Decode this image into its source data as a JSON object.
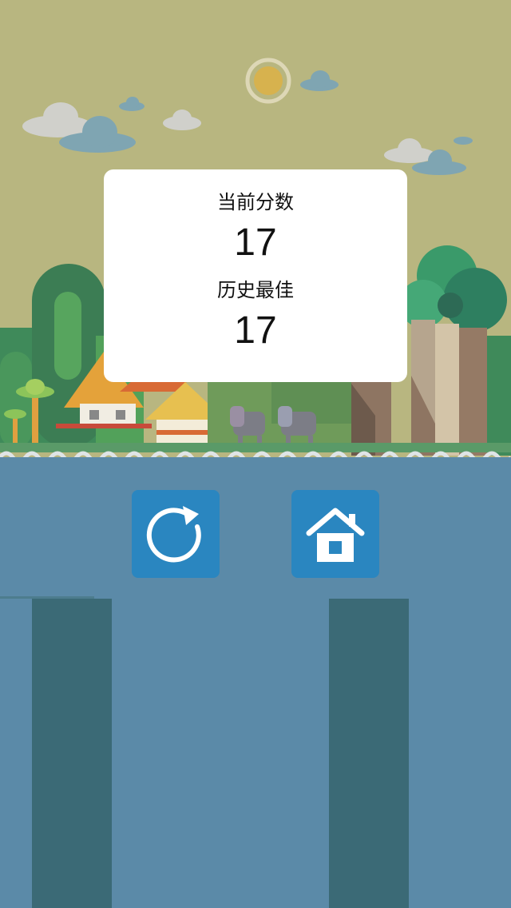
{
  "scene": {
    "colors": {
      "sky": "#b8b680",
      "water": "#5b8aa8",
      "pillar": "#3b6a76",
      "button": "#2a86c0",
      "panel": "#ffffff"
    },
    "background_elements": [
      "sun",
      "clouds",
      "palm-trees",
      "huts",
      "elephants",
      "jungle-trees",
      "wave-shoreline"
    ]
  },
  "score_panel": {
    "current_label": "当前分数",
    "current_value": "17",
    "best_label": "历史最佳",
    "best_value": "17"
  },
  "buttons": {
    "restart_icon": "restart-icon",
    "home_icon": "home-icon"
  }
}
